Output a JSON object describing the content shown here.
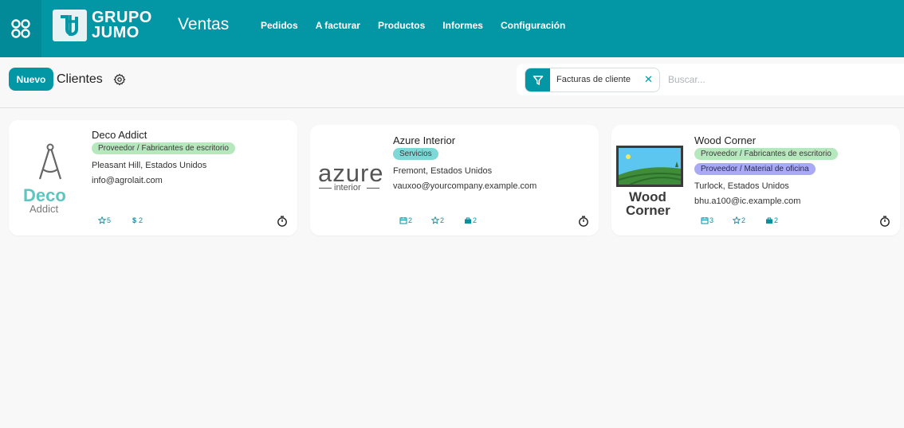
{
  "app": {
    "logo_line1": "GRUPO",
    "logo_line2": "JUMO",
    "name": "Ventas"
  },
  "nav": [
    "Pedidos",
    "A facturar",
    "Productos",
    "Informes",
    "Configuración"
  ],
  "control": {
    "new_label": "Nuevo",
    "breadcrumb": "Clientes"
  },
  "search": {
    "facet_label": "Facturas de cliente",
    "placeholder": "Buscar..."
  },
  "colors": {
    "brand": "#0397a6",
    "tag_green": "#b6e8be",
    "tag_teal": "#7fd8d8",
    "tag_purple": "#a9a9f5"
  },
  "cards": [
    {
      "name": "Deco Addict",
      "tags": [
        "Proveedor / Fabricantes de escritorio"
      ],
      "location": "Pleasant Hill, Estados Unidos",
      "email": "info@agrolait.com",
      "logo": {
        "line1": "Deco",
        "line2": "Addict"
      },
      "stats": [
        {
          "icon": "star-icon",
          "value": "5"
        },
        {
          "icon": "dollar-icon",
          "value": "2"
        }
      ]
    },
    {
      "name": "Azure Interior",
      "tags": [
        "Servicios"
      ],
      "location": "Fremont, Estados Unidos",
      "email": "vauxoo@yourcompany.example.com",
      "logo": {
        "line1": "azure",
        "line2": "interior"
      },
      "stats": [
        {
          "icon": "calendar-icon",
          "value": "2"
        },
        {
          "icon": "star-icon",
          "value": "2"
        },
        {
          "icon": "bag-icon",
          "value": "2"
        }
      ]
    },
    {
      "name": "Wood Corner",
      "tags": [
        "Proveedor / Fabricantes de escritorio",
        "Proveedor / Material de oficina"
      ],
      "location": "Turlock, Estados Unidos",
      "email": "bhu.a100@ic.example.com",
      "logo": {
        "line1": "Wood",
        "line2": "Corner"
      },
      "stats": [
        {
          "icon": "calendar-icon",
          "value": "3"
        },
        {
          "icon": "star-icon",
          "value": "2"
        },
        {
          "icon": "bag-icon",
          "value": "2"
        }
      ]
    }
  ]
}
